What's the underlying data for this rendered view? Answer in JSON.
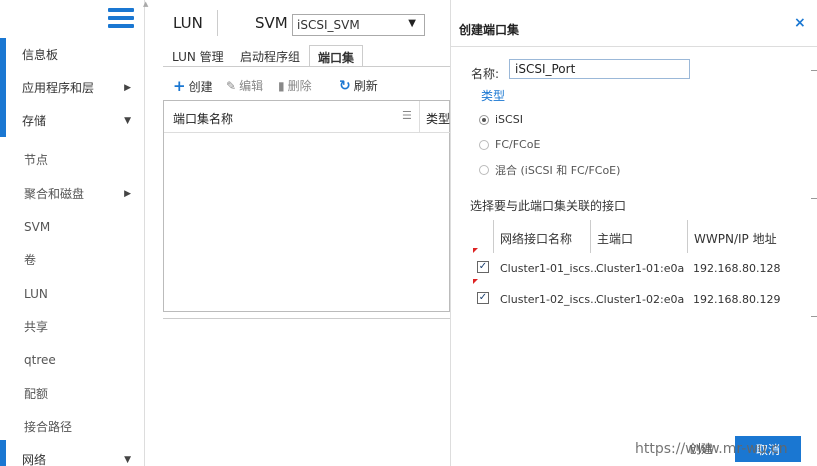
{
  "sidebar": {
    "items": [
      {
        "label": "信息板",
        "arrow": ""
      },
      {
        "label": "应用程序和层",
        "arrow": "▶"
      },
      {
        "label": "存储",
        "arrow": "▼"
      },
      {
        "label": "节点",
        "arrow": ""
      },
      {
        "label": "聚合和磁盘",
        "arrow": "▶"
      },
      {
        "label": "SVM",
        "arrow": ""
      },
      {
        "label": "卷",
        "arrow": ""
      },
      {
        "label": "LUN",
        "arrow": ""
      },
      {
        "label": "共享",
        "arrow": ""
      },
      {
        "label": "qtree",
        "arrow": ""
      },
      {
        "label": "配额",
        "arrow": ""
      },
      {
        "label": "接合路径",
        "arrow": ""
      },
      {
        "label": "网络",
        "arrow": "▼"
      }
    ]
  },
  "header": {
    "title": "LUN",
    "svm_label": "SVM",
    "svm_value": "iSCSI_SVM",
    "svm_caret": "▼"
  },
  "tabs": [
    "LUN 管理",
    "启动程序组",
    "端口集"
  ],
  "toolbar": {
    "create": "创建",
    "edit": "编辑",
    "delete": "删除",
    "refresh": "刷新"
  },
  "grid": {
    "columns": [
      "端口集名称",
      "类型"
    ]
  },
  "dialog": {
    "title": "创建端口集",
    "close": "×",
    "name_label": "名称:",
    "name_value": "iSCSI_Port",
    "type_label": "类型",
    "types": [
      "iSCSI",
      "FC/FCoE",
      "混合 (iSCSI 和 FC/FCoE)"
    ],
    "selected_type": "iSCSI",
    "assoc_label": "选择要与此端口集关联的接口",
    "table_headers": [
      "网络接口名称",
      "主端口",
      "WWPN/IP 地址"
    ],
    "rows": [
      {
        "checked": true,
        "name": "Cluster1-01_iscs...",
        "port": "Cluster1-01:e0a",
        "address": "192.168.80.128"
      },
      {
        "checked": true,
        "name": "Cluster1-02_iscs...",
        "port": "Cluster1-02:e0a",
        "address": "192.168.80.129"
      }
    ],
    "create_button": "创建",
    "cancel_button": "取消"
  },
  "watermark": "https://www.mr-wu.cn",
  "colors": {
    "accent": "#1a77d2",
    "flag": "#dd2222"
  }
}
